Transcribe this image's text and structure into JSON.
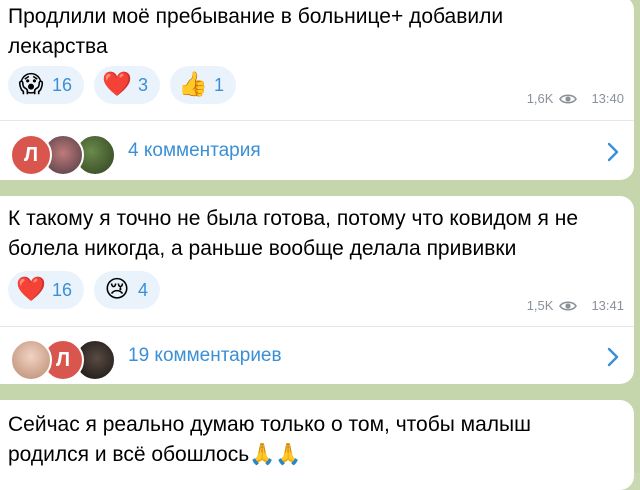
{
  "colors": {
    "accent": "#3a8fd6",
    "reaction_bg": "#eaf3fc",
    "meta": "#8a9199",
    "chat_bg": "#c9d9b4"
  },
  "posts": [
    {
      "text": "Продлили моё пребывание в больнице+ добавили\nлекарства",
      "reactions": [
        {
          "emoji": "😱",
          "icon": "screaming-face-icon",
          "count": "16"
        },
        {
          "emoji": "❤️",
          "icon": "red-heart-icon",
          "count": "3"
        },
        {
          "emoji": "👍",
          "icon": "thumbs-up-icon",
          "count": "1"
        }
      ],
      "views": "1,6K",
      "time": "13:40",
      "comments": {
        "label": "4 комментария",
        "avatar_letter": "Л"
      }
    },
    {
      "text": "К такому я точно не была готова, потому что ковидом я не\nболела никогда, а раньше вообще делала прививки",
      "reactions": [
        {
          "emoji": "❤️",
          "icon": "red-heart-icon",
          "count": "16"
        },
        {
          "emoji": "😢",
          "icon": "crying-face-icon",
          "count": "4"
        }
      ],
      "views": "1,5K",
      "time": "13:41",
      "comments": {
        "label": "19 комментариев",
        "avatar_letter": "Л"
      }
    },
    {
      "text": "Сейчас я реально думаю только о том, чтобы малыш\nродился и всё обошлось🙏🙏"
    }
  ]
}
